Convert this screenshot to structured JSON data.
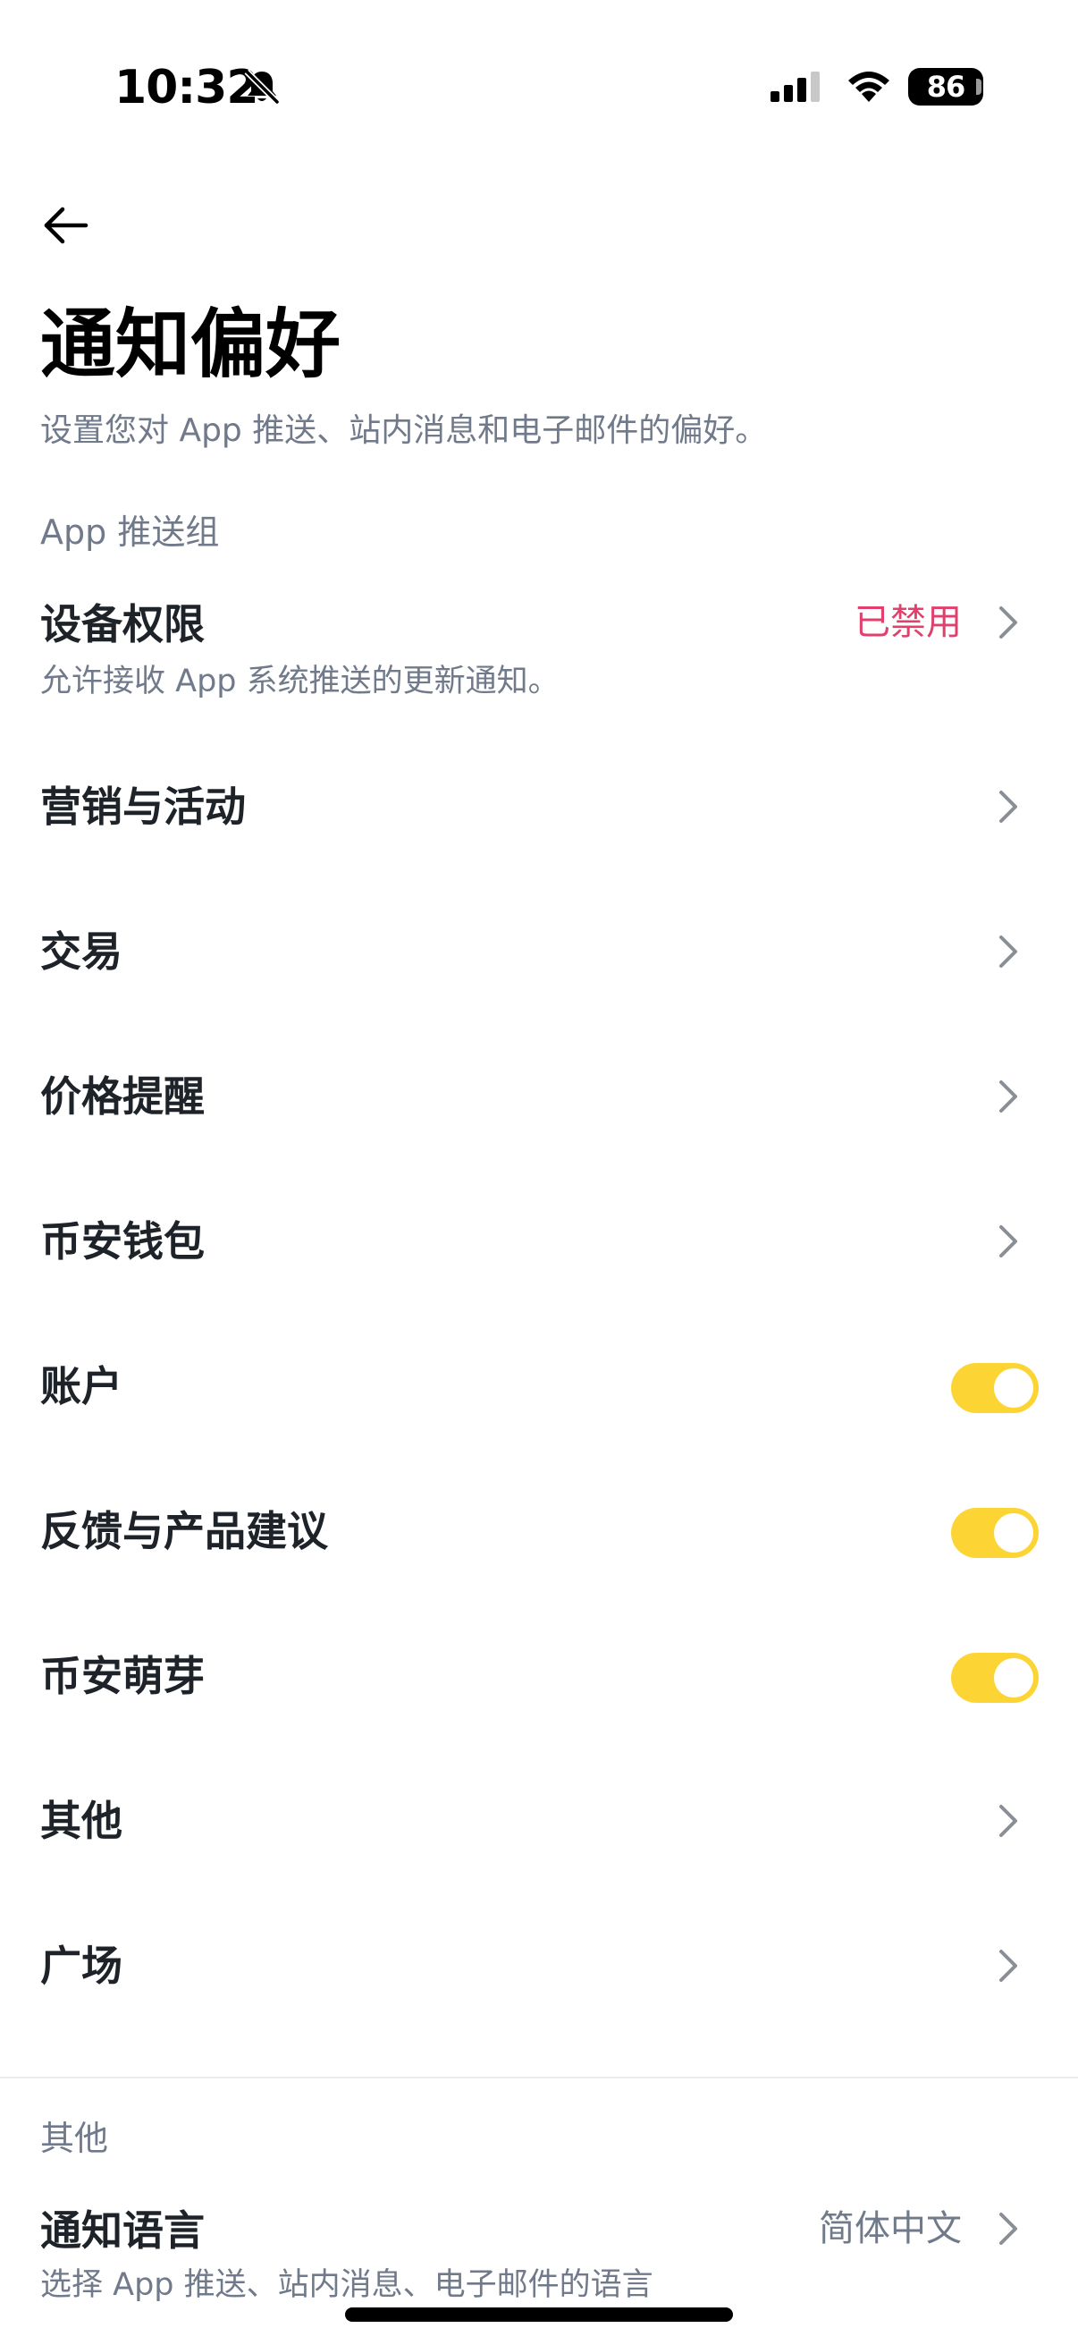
{
  "status_bar": {
    "time": "10:32",
    "battery": "86"
  },
  "page": {
    "title": "通知偏好",
    "subtitle": "设置您对 App 推送、站内消息和电子邮件的偏好。"
  },
  "app_push_group": {
    "label": "App 推送组",
    "device_permission": {
      "label": "设备权限",
      "description": "允许接收 App 系统推送的更新通知。",
      "status": "已禁用",
      "status_color": "#e0406b"
    },
    "items": [
      {
        "label": "营销与活动",
        "control": "chevron"
      },
      {
        "label": "交易",
        "control": "chevron"
      },
      {
        "label": "价格提醒",
        "control": "chevron"
      },
      {
        "label": "币安钱包",
        "control": "chevron"
      },
      {
        "label": "账户",
        "control": "toggle",
        "enabled": true
      },
      {
        "label": "反馈与产品建议",
        "control": "toggle",
        "enabled": true
      },
      {
        "label": "币安萌芽",
        "control": "toggle",
        "enabled": true
      },
      {
        "label": "其他",
        "control": "chevron"
      },
      {
        "label": "广场",
        "control": "chevron"
      }
    ]
  },
  "other_group": {
    "label": "其他",
    "notification_language": {
      "label": "通知语言",
      "description": "选择 App 推送、站内消息、电子邮件的语言",
      "value": "简体中文"
    }
  },
  "colors": {
    "toggle_on": "#fcd535",
    "secondary_text": "#707a8a",
    "chevron": "#8a8f96"
  },
  "icons": {
    "back": "arrow-left-icon",
    "chevron": "chevron-right-icon",
    "silent": "bell-slash-icon",
    "signal": "cellular-signal-icon",
    "wifi": "wifi-icon",
    "battery": "battery-icon"
  }
}
